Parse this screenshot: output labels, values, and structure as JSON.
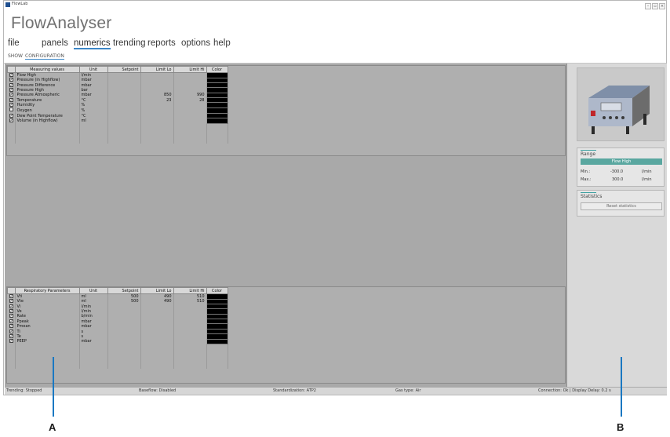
{
  "window": {
    "title": "FlowLab",
    "minimize": "–",
    "maximize": "▫",
    "close": "×"
  },
  "app_heading": "FlowAnalyser",
  "menu": [
    {
      "label": "file"
    },
    {
      "label": "panels"
    },
    {
      "label": "numerics",
      "active": true
    },
    {
      "label": "trending"
    },
    {
      "label": "reports"
    },
    {
      "label": "options"
    },
    {
      "label": "help"
    }
  ],
  "subtabs": [
    {
      "label": "SHOW"
    },
    {
      "label": "CONFIGURATION",
      "active": true
    }
  ],
  "measuring_table": {
    "headers": {
      "name": "Measuring values",
      "unit": "Unit",
      "setpoint": "Setpoint",
      "limit_lo": "Limit Lo",
      "limit_hi": "Limit Hi",
      "color": "Color"
    },
    "rows": [
      {
        "checked": true,
        "name": "Flow High",
        "unit": "l/min",
        "setpoint": "",
        "limit_lo": "",
        "limit_hi": ""
      },
      {
        "checked": true,
        "name": "Pressure (in Highflow)",
        "unit": "mbar",
        "setpoint": "",
        "limit_lo": "",
        "limit_hi": ""
      },
      {
        "checked": true,
        "name": "Pressure Difference",
        "unit": "mbar",
        "setpoint": "",
        "limit_lo": "",
        "limit_hi": ""
      },
      {
        "checked": true,
        "name": "Pressure High",
        "unit": "bar",
        "setpoint": "",
        "limit_lo": "",
        "limit_hi": ""
      },
      {
        "checked": true,
        "name": "Pressure Atmospheric",
        "unit": "mbar",
        "setpoint": "",
        "limit_lo": "850",
        "limit_hi": "990"
      },
      {
        "checked": true,
        "name": "Temperature",
        "unit": "°C",
        "setpoint": "",
        "limit_lo": "23",
        "limit_hi": "28"
      },
      {
        "checked": true,
        "name": "Humidity",
        "unit": "%",
        "setpoint": "",
        "limit_lo": "",
        "limit_hi": ""
      },
      {
        "checked": false,
        "name": "Oxygen",
        "unit": "%",
        "setpoint": "",
        "limit_lo": "",
        "limit_hi": ""
      },
      {
        "checked": true,
        "name": "Dew Point Temperature",
        "unit": "°C",
        "setpoint": "",
        "limit_lo": "",
        "limit_hi": ""
      },
      {
        "checked": true,
        "name": "Volume (in Highflow)",
        "unit": "ml",
        "setpoint": "",
        "limit_lo": "",
        "limit_hi": ""
      }
    ]
  },
  "resp_table": {
    "headers": {
      "name": "Respiratory Parameters",
      "unit": "Unit",
      "setpoint": "Setpoint",
      "limit_lo": "Limit Lo",
      "limit_hi": "Limit Hi",
      "color": "Color"
    },
    "rows": [
      {
        "checked": true,
        "name": "Vti",
        "unit": "ml",
        "setpoint": "500",
        "limit_lo": "490",
        "limit_hi": "510"
      },
      {
        "checked": true,
        "name": "Vte",
        "unit": "ml",
        "setpoint": "500",
        "limit_lo": "490",
        "limit_hi": "510"
      },
      {
        "checked": true,
        "name": "Vi",
        "unit": "l/min",
        "setpoint": "",
        "limit_lo": "",
        "limit_hi": ""
      },
      {
        "checked": true,
        "name": "Ve",
        "unit": "l/min",
        "setpoint": "",
        "limit_lo": "",
        "limit_hi": ""
      },
      {
        "checked": true,
        "name": "Rate",
        "unit": "b/min",
        "setpoint": "",
        "limit_lo": "",
        "limit_hi": ""
      },
      {
        "checked": true,
        "name": "Ppeak",
        "unit": "mbar",
        "setpoint": "",
        "limit_lo": "",
        "limit_hi": ""
      },
      {
        "checked": true,
        "name": "Pmean",
        "unit": "mbar",
        "setpoint": "",
        "limit_lo": "",
        "limit_hi": ""
      },
      {
        "checked": true,
        "name": "Ti",
        "unit": "s",
        "setpoint": "",
        "limit_lo": "",
        "limit_hi": ""
      },
      {
        "checked": true,
        "name": "Te",
        "unit": "s",
        "setpoint": "",
        "limit_lo": "",
        "limit_hi": ""
      },
      {
        "checked": true,
        "name": "PEEP",
        "unit": "mbar",
        "setpoint": "",
        "limit_lo": "",
        "limit_hi": ""
      }
    ]
  },
  "range_panel": {
    "title": "Range",
    "selected": "Flow High",
    "min_label": "Min.:",
    "min_value": "-300.0",
    "min_unit": "l/min",
    "max_label": "Max.:",
    "max_value": "300.0",
    "max_unit": "l/min"
  },
  "stats_panel": {
    "title": "Statistics",
    "reset_label": "Reset statistics"
  },
  "statusbar": {
    "trending": "Trending: Stopped",
    "baseflow": "Baseflow: Disabled",
    "standardization": "Standardization: ATP2",
    "gas_type": "Gas type: Air",
    "connection": "Connection: Ok | Display Delay: 0.2 s"
  },
  "callouts": {
    "a": "A",
    "b": "B"
  },
  "colors": {
    "accent": "#3b86c6",
    "callout_line": "#1a78c2",
    "swatch": "#000000",
    "range_bar": "#5aa7a0"
  }
}
